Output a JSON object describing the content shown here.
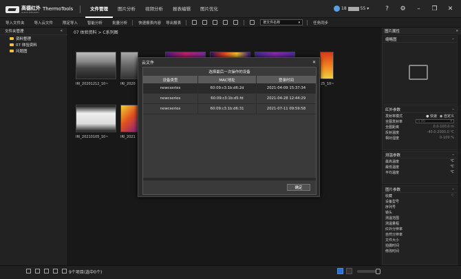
{
  "app": {
    "brand": "高德红外",
    "brand_sub": "GUIDE INFRARED",
    "name": "ThermoTools"
  },
  "menu": [
    "文件管理",
    "图片分析",
    "视频分析",
    "报表编辑",
    "图片优化"
  ],
  "user": {
    "id_prefix": "18",
    "id_suffix": "55"
  },
  "toolbar": {
    "items": [
      "导入文件夹",
      "导入云文件",
      "限定导入",
      "智能分析",
      "批量分析",
      "快速报表内容",
      "导出报表"
    ],
    "select_value": "按文件名称",
    "sync": "任务同步"
  },
  "sidebar": {
    "title": "文件夹管理",
    "collapse": "«",
    "items": [
      "资料整理",
      "07 体验资料",
      "问题图"
    ]
  },
  "breadcrumb": "07 体验资料 > C系列图",
  "thumbs": [
    {
      "label": "IRI_20201212_10~"
    },
    {
      "label": "IRI_2020"
    },
    {
      "label": ""
    },
    {
      "label": ""
    },
    {
      "label": "25_10~"
    },
    {
      "label": "IRI_20210105_10~"
    },
    {
      "label": "IRI_2021"
    }
  ],
  "dialog": {
    "title": "云文件",
    "caption": "选择最后一次操作的设备",
    "columns": [
      "设备类型",
      "MAC地址",
      "登录时间"
    ],
    "rows": [
      [
        "newcseries",
        "60:09:c3:1b:d6:2d",
        "2021-04-09 15:37:34"
      ],
      [
        "newcseries",
        "60:09:c3:1b:d5:fd",
        "2021-04-28 12:44:29"
      ],
      [
        "newcseries",
        "60:09:c3:1b:d6:31",
        "2021-07-11 09:59:58"
      ]
    ],
    "confirm": "确定"
  },
  "right": {
    "header": "图片属性",
    "thumb_panel": "缩略图",
    "ir_panel": {
      "title": "红外参数",
      "mode_label": "发射率模式",
      "opt1": "快速",
      "opt2": "自定义",
      "rows": [
        [
          "全图发射率",
          ""
        ],
        [
          "全图距离",
          "0.0-100.0 m"
        ],
        [
          "反射温度",
          "-40.0-2000.0 ℃"
        ],
        [
          "相对湿度",
          "0-100 %"
        ]
      ],
      "emis_val": "0.95"
    },
    "temp_panel": {
      "title": "测温参数",
      "rows": [
        [
          "最高温度",
          "℃"
        ],
        [
          "最低温度",
          "℃"
        ],
        [
          "平均温度",
          "℃"
        ]
      ]
    },
    "img_panel": {
      "title": "图片参数",
      "rows": [
        "收藏",
        "设备型号",
        "序列号",
        "镜头",
        "测温范围",
        "测温量程",
        "红外分辨率",
        "自然分辨率",
        "文件大小",
        "拍摄时间",
        "修改时间"
      ]
    }
  },
  "status": {
    "count": "9个项目(选中0个)"
  }
}
